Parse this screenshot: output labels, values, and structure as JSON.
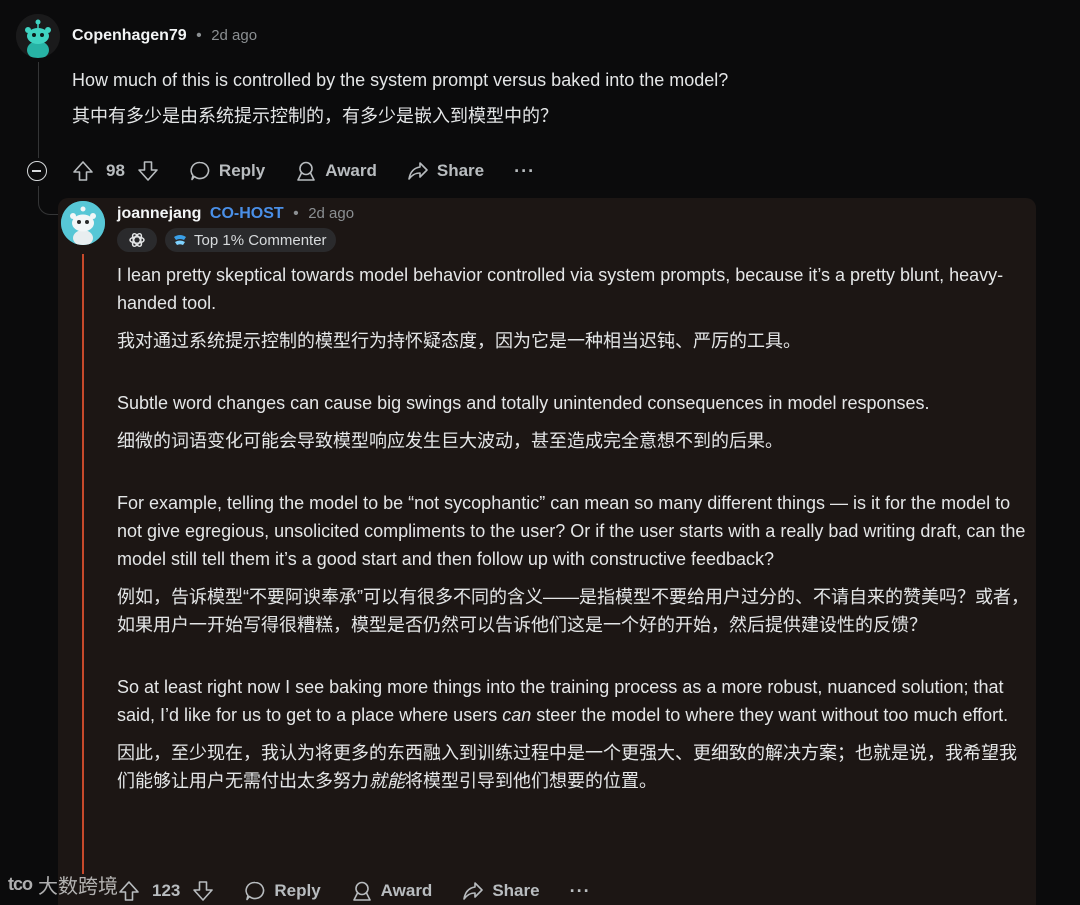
{
  "top_comment": {
    "author": "Copenhagen79",
    "separator": "•",
    "time": "2d ago",
    "paragraphs": [
      "How much of this is controlled by the system prompt versus baked into the model?",
      "其中有多少是由系统提示控制的，有多少是嵌入到模型中的？"
    ],
    "actions": {
      "upvotes": "98",
      "reply": "Reply",
      "award": "Award",
      "share": "Share",
      "more": "···"
    }
  },
  "reply_comment": {
    "author": "joannejang",
    "flair": "CO-HOST",
    "separator": "•",
    "time": "2d ago",
    "badge_label": "Top 1% Commenter",
    "paragraphs": {
      "p1_en": "I lean pretty skeptical towards model behavior controlled via system prompts, because it’s a pretty blunt, heavy-handed tool.",
      "p1_zh": "我对通过系统提示控制的模型行为持怀疑态度，因为它是一种相当迟钝、严厉的工具。",
      "p2_en": "Subtle word changes can cause big swings and totally unintended consequences in model responses.",
      "p2_zh": "细微的词语变化可能会导致模型响应发生巨大波动，甚至造成完全意想不到的后果。",
      "p3_en": "For example, telling the model to be “not sycophantic” can mean so many different things — is it for the model to not give egregious, unsolicited compliments to the user? Or if the user starts with a really bad writing draft, can the model still tell them it’s a good start and then follow up with constructive feedback?",
      "p3_zh": "例如，告诉模型“不要阿谀奉承”可以有很多不同的含义——是指模型不要给用户过分的、不请自来的赞美吗？或者，如果用户一开始写得很糟糕，模型是否仍然可以告诉他们这是一个好的开始，然后提供建设性的反馈？",
      "p4_en_a": "So at least right now I see baking more things into the training process as a more robust, nuanced solution; that said, I’d like for us to get to a place where users ",
      "p4_en_em": "can",
      "p4_en_b": " steer the model to where they want without too much effort.",
      "p4_zh_a": "因此，至少现在，我认为将更多的东西融入到训练过程中是一个更强大、更细致的解决方案；也就是说，我希望我们能够让用户无需付出太多努力",
      "p4_zh_em": "就能",
      "p4_zh_b": "将模型引导到他们想要的位置。"
    },
    "actions": {
      "upvotes": "123",
      "reply": "Reply",
      "award": "Award",
      "share": "Share",
      "more": "···"
    }
  },
  "watermark": {
    "logo": "tco",
    "text": "大数跨境"
  },
  "colors": {
    "background": "#0b0b0c",
    "card": "#1c1614",
    "accent_line": "#c6492b",
    "cohost": "#4a8fe7"
  }
}
